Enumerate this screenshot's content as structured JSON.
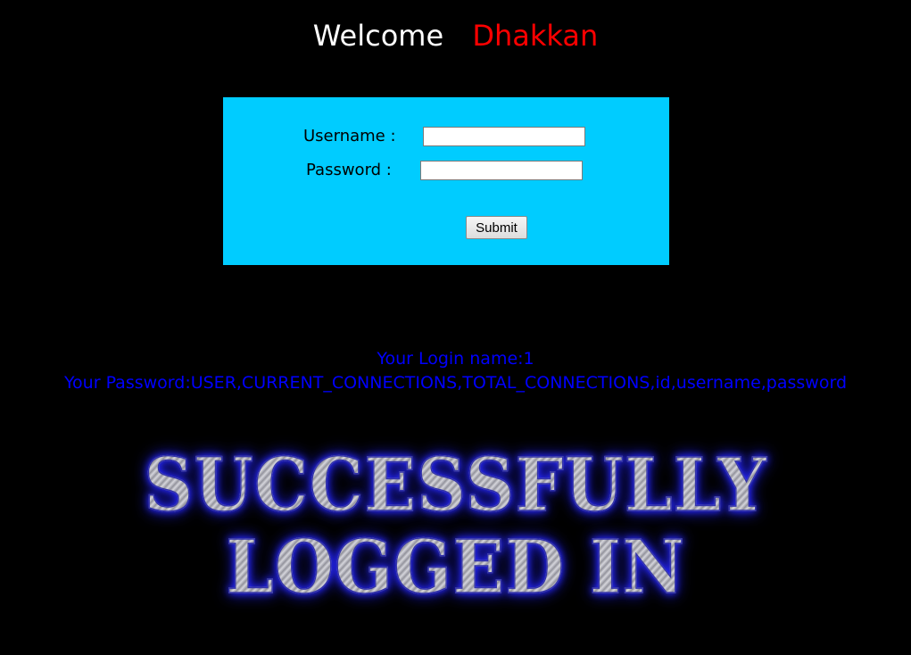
{
  "header": {
    "welcome": "Welcome",
    "name": "Dhakkan"
  },
  "form": {
    "username_label": "Username :",
    "password_label": "Password :",
    "username_value": "",
    "password_value": "",
    "submit_label": "Submit"
  },
  "result": {
    "login_name": "Your Login name:1",
    "password": "Your Password:USER,CURRENT_CONNECTIONS,TOTAL_CONNECTIONS,id,username,password"
  },
  "banner": {
    "line1": "SUCCESSFULLY",
    "line2": "LOGGED IN"
  },
  "colors": {
    "background": "#000000",
    "form_background": "#00ccff",
    "name": "#ff0000",
    "result_text": "#0000ff"
  }
}
